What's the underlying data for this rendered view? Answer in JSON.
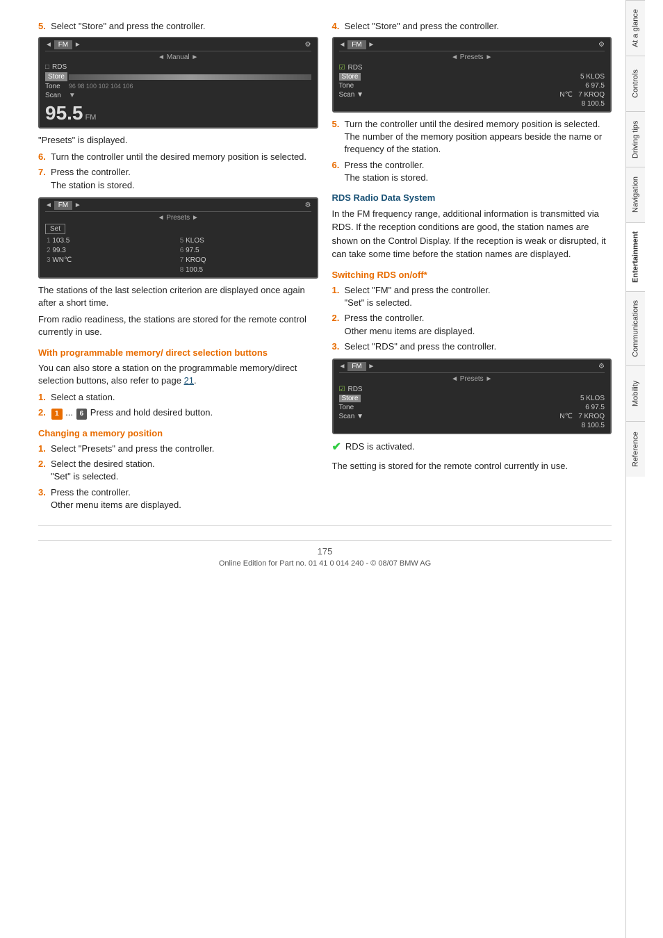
{
  "page": {
    "number": "175",
    "footer": "Online Edition for Part no. 01 41 0 014 240 - © 08/07 BMW AG"
  },
  "sidebar": {
    "tabs": [
      {
        "label": "At a glance",
        "active": false
      },
      {
        "label": "Controls",
        "active": false
      },
      {
        "label": "Driving tips",
        "active": false
      },
      {
        "label": "Navigation",
        "active": false
      },
      {
        "label": "Entertainment",
        "active": true
      },
      {
        "label": "Communications",
        "active": false
      },
      {
        "label": "Mobility",
        "active": false
      },
      {
        "label": "Reference",
        "active": false
      }
    ]
  },
  "left_column": {
    "step5_label": "5.",
    "step5_text": "Select \"Store\" and press the controller.",
    "screen1": {
      "header_left": "◄",
      "header_center": "FM ►",
      "header_right": "⚙",
      "sub": "◄ Manual ►",
      "rows": [
        {
          "label": "□ RDS",
          "value": ""
        },
        {
          "label": "Store",
          "value": ""
        },
        {
          "label": "Tone",
          "value": "96  98  100 102 104 106"
        },
        {
          "label": "Scan",
          "value": "▼"
        }
      ],
      "freq": "95.5",
      "freq_unit": "FM"
    },
    "note1": "\"Presets\" is displayed.",
    "steps_after": [
      {
        "num": "6.",
        "text": "Turn the controller until the desired memory position is selected."
      },
      {
        "num": "7.",
        "text": "Press the controller.\nThe station is stored."
      }
    ],
    "screen2": {
      "header_left": "◄",
      "header_center": "FM ►",
      "header_right": "⚙",
      "sub": "◄ Presets ►",
      "set_label": "Set",
      "presets": [
        {
          "num": "1",
          "freq": "103.5",
          "num2": "5",
          "station2": "KLOS"
        },
        {
          "num": "2",
          "freq": "99.3",
          "num2": "6",
          "freq2": "97.5"
        },
        {
          "num": "3",
          "station": "WN℃",
          "num2": "7",
          "station2": "KROQ"
        },
        {
          "num": "",
          "freq": "",
          "num2": "8",
          "freq2": "100.5"
        }
      ]
    },
    "note2": "The stations of the last selection criterion are displayed once again after a short time.",
    "note3": "From radio readiness, the stations are stored for the remote control currently in use.",
    "section1_heading": "With programmable memory/ direct selection buttons",
    "section1_text": "You can also store a station on the programmable memory/direct selection buttons, also refer to page 21.",
    "steps_section1": [
      {
        "num": "1.",
        "text": "Select a station."
      },
      {
        "num": "2.",
        "text": "Press and hold desired button.",
        "has_buttons": true
      }
    ],
    "section2_heading": "Changing a memory position",
    "steps_section2": [
      {
        "num": "1.",
        "text": "Select \"Presets\" and press the controller."
      },
      {
        "num": "2.",
        "text": "Select the desired station.\n\"Set\" is selected."
      },
      {
        "num": "3.",
        "text": "Press the controller.\nOther menu items are displayed."
      }
    ]
  },
  "right_column": {
    "step4_label": "4.",
    "step4_text": "Select \"Store\" and press the controller.",
    "screen1": {
      "header_left": "◄",
      "header_center": "FM ►",
      "header_right": "⚙",
      "sub": "◄ Presets ►",
      "rows": [
        {
          "label": "☑ RDS",
          "value": ""
        },
        {
          "label": "Store",
          "value": "5 KLOS"
        },
        {
          "label": "Tone",
          "value": "6 97.5"
        },
        {
          "label": "Scan",
          "value": "▼  N℃   7 KROQ"
        }
      ],
      "last_row": "8 100.5"
    },
    "steps_after": [
      {
        "num": "5.",
        "text": "Turn the controller until the desired memory position is selected.\nThe number of the memory position appears beside the name or frequency of the station."
      },
      {
        "num": "6.",
        "text": "Press the controller.\nThe station is stored."
      }
    ],
    "rds_heading": "RDS Radio Data System",
    "rds_text": "In the FM frequency range, additional information is transmitted via RDS. If the reception conditions are good, the station names are shown on the Control Display. If the reception is weak or disrupted, it can take some time before the station names are displayed.",
    "switching_heading": "Switching RDS on/off*",
    "steps_switching": [
      {
        "num": "1.",
        "text": "Select \"FM\" and press the controller.\n\"Set\" is selected."
      },
      {
        "num": "2.",
        "text": "Press the controller.\nOther menu items are displayed."
      },
      {
        "num": "3.",
        "text": "Select \"RDS\" and press the controller."
      }
    ],
    "screen2": {
      "header_left": "◄",
      "header_center": "FM ►",
      "header_right": "⚙",
      "sub": "◄ Presets ►",
      "rows": [
        {
          "label": "☑ RDS",
          "value": ""
        },
        {
          "label": "Store",
          "value": "5 KLOS"
        },
        {
          "label": "Tone",
          "value": "6 97.5"
        },
        {
          "label": "Scan",
          "value": "▼  N℃   7 KROQ"
        }
      ],
      "last_row": "8 100.5"
    },
    "rds_activated": "RDS is activated.",
    "rds_note": "The setting is stored for the remote control currently in use."
  }
}
